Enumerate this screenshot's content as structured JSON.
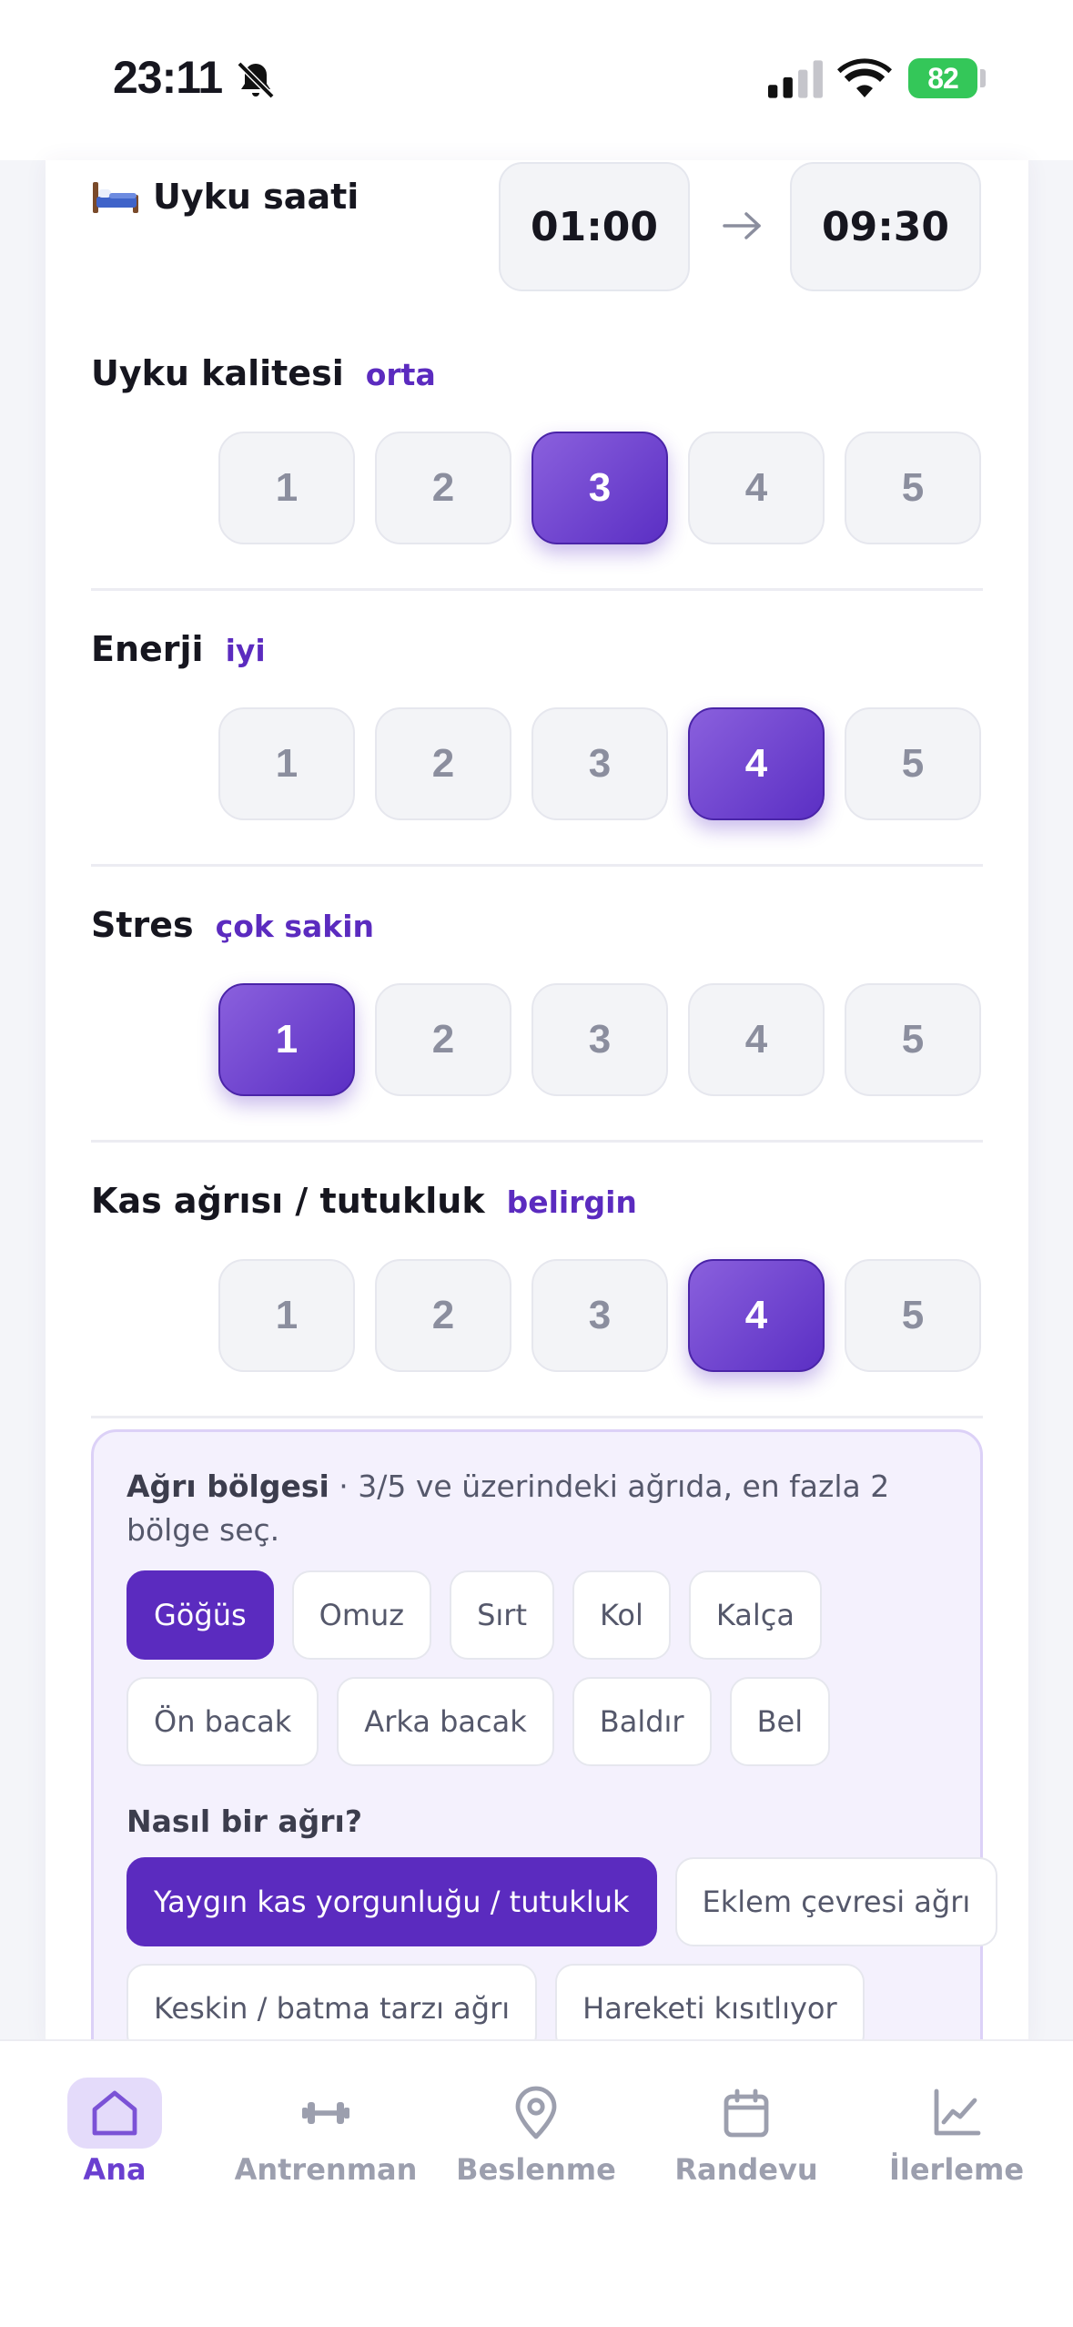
{
  "status_bar": {
    "time": "23:11",
    "battery": "82",
    "icons": [
      "bell-off-icon",
      "signal-icon",
      "wifi-icon",
      "battery-charging-icon"
    ]
  },
  "sleep": {
    "label": "Uyku saati",
    "icon": "bed-icon",
    "start": "01:00",
    "end": "09:30"
  },
  "metrics": [
    {
      "title": "Uyku kalitesi",
      "value_text": "orta",
      "selected": 3,
      "options": [
        "1",
        "2",
        "3",
        "4",
        "5"
      ]
    },
    {
      "title": "Enerji",
      "value_text": "iyi",
      "selected": 4,
      "options": [
        "1",
        "2",
        "3",
        "4",
        "5"
      ]
    },
    {
      "title": "Stres",
      "value_text": "çok sakin",
      "selected": 1,
      "options": [
        "1",
        "2",
        "3",
        "4",
        "5"
      ]
    },
    {
      "title": "Kas ağrısı / tutukluk",
      "value_text": "belirgin",
      "selected": 4,
      "options": [
        "1",
        "2",
        "3",
        "4",
        "5"
      ]
    }
  ],
  "pain": {
    "title": "Ağrı bölgesi",
    "description": " · 3/5 ve üzerindeki ağrıda, en fazla 2 bölge seç.",
    "regions_row1": [
      "Göğüs",
      "Omuz",
      "Sırt",
      "Kol",
      "Kalça"
    ],
    "regions_row2": [
      "Ön bacak",
      "Arka bacak",
      "Baldır",
      "Bel"
    ],
    "selected_region": "Göğüs",
    "question": "Nasıl bir ağrı?",
    "types_row1": [
      "Yaygın kas yorgunluğu / tutukluk",
      "Eklem çevresi ağrı"
    ],
    "types_row2": [
      "Keskin / batma tarzı ağrı",
      "Hareketi kısıtlıyor"
    ],
    "selected_type": "Yaygın kas yorgunluğu / tutukluk"
  },
  "nav": {
    "items": [
      {
        "label": "Ana",
        "icon": "home-icon",
        "active": true
      },
      {
        "label": "Antrenman",
        "icon": "dumbbell-icon",
        "active": false
      },
      {
        "label": "Beslenme",
        "icon": "location-pin-icon",
        "active": false
      },
      {
        "label": "Randevu",
        "icon": "calendar-icon",
        "active": false
      },
      {
        "label": "İlerleme",
        "icon": "chart-line-icon",
        "active": false
      }
    ]
  },
  "colors": {
    "accent": "#5b2bbf",
    "accent_light": "#8a60dd",
    "battery": "#34c759",
    "pain_bg": "#f4f1fd"
  }
}
